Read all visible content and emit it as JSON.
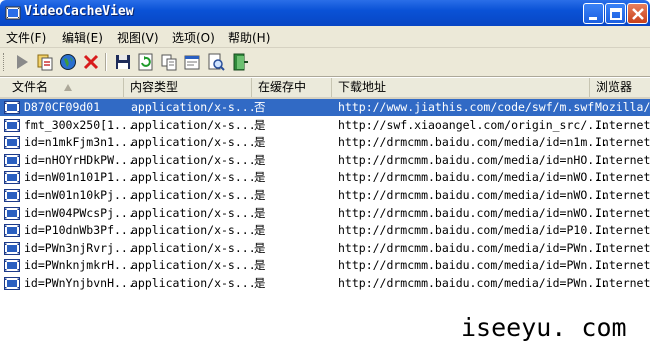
{
  "window": {
    "title": "VideoCacheView"
  },
  "menu": [
    {
      "label": "文件(F)"
    },
    {
      "label": "编辑(E)"
    },
    {
      "label": "视图(V)"
    },
    {
      "label": "选项(O)"
    },
    {
      "label": "帮助(H)"
    }
  ],
  "toolbar": {
    "icons": [
      "play-icon",
      "copy-files-icon",
      "globe-icon",
      "delete-icon",
      "save-icon",
      "refresh-icon",
      "copy-icon",
      "properties-icon",
      "find-icon",
      "exit-icon"
    ]
  },
  "columns": [
    "文件名",
    "内容类型",
    "在缓存中",
    "下载地址",
    "浏览器"
  ],
  "rows": [
    {
      "name": "D870CF09d01",
      "type": "application/x-s...",
      "cached": "否",
      "url": "http://www.jiathis.com/code/swf/m.swf",
      "browser": "Mozilla/F"
    },
    {
      "name": "fmt_300x250[1...",
      "type": "application/x-s...",
      "cached": "是",
      "url": "http://swf.xiaoangel.com/origin_src/...",
      "browser": "Internet"
    },
    {
      "name": "id=n1mkFjm3n1...",
      "type": "application/x-s...",
      "cached": "是",
      "url": "http://drmcmm.baidu.com/media/id=n1m...",
      "browser": "Internet"
    },
    {
      "name": "id=nHOYrHDkPW...",
      "type": "application/x-s...",
      "cached": "是",
      "url": "http://drmcmm.baidu.com/media/id=nHO...",
      "browser": "Internet"
    },
    {
      "name": "id=nW01n101P1...",
      "type": "application/x-s...",
      "cached": "是",
      "url": "http://drmcmm.baidu.com/media/id=nWO...",
      "browser": "Internet"
    },
    {
      "name": "id=nW01n10kPj...",
      "type": "application/x-s...",
      "cached": "是",
      "url": "http://drmcmm.baidu.com/media/id=nWO...",
      "browser": "Internet"
    },
    {
      "name": "id=nW04PWcsPj...",
      "type": "application/x-s...",
      "cached": "是",
      "url": "http://drmcmm.baidu.com/media/id=nWO...",
      "browser": "Internet"
    },
    {
      "name": "id=P10dnWb3Pf...",
      "type": "application/x-s...",
      "cached": "是",
      "url": "http://drmcmm.baidu.com/media/id=P10...",
      "browser": "Internet"
    },
    {
      "name": "id=PWn3njRvrj...",
      "type": "application/x-s...",
      "cached": "是",
      "url": "http://drmcmm.baidu.com/media/id=PWn...",
      "browser": "Internet"
    },
    {
      "name": "id=PWnknjmkrH...",
      "type": "application/x-s...",
      "cached": "是",
      "url": "http://drmcmm.baidu.com/media/id=PWn...",
      "browser": "Internet"
    },
    {
      "name": "id=PWnYnjbvnH...",
      "type": "application/x-s...",
      "cached": "是",
      "url": "http://drmcmm.baidu.com/media/id=PWn...",
      "browser": "Internet"
    }
  ],
  "selected_row": 0,
  "watermark": "iseeyu. com",
  "colors": {
    "titlebar": "#0a52d6",
    "selection": "#316ac5",
    "chrome": "#ece9d8"
  }
}
